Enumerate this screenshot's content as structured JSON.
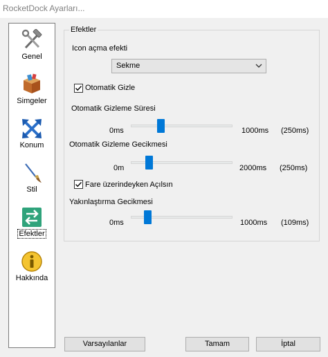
{
  "window": {
    "title": "RocketDock Ayarları..."
  },
  "sidebar": {
    "items": [
      {
        "label": "Genel",
        "icon": "tools-icon"
      },
      {
        "label": "Simgeler",
        "icon": "box-icon"
      },
      {
        "label": "Konum",
        "icon": "position-arrows-icon"
      },
      {
        "label": "Stil",
        "icon": "brush-icon"
      },
      {
        "label": "Efektler",
        "icon": "swap-arrows-icon"
      },
      {
        "label": "Hakkında",
        "icon": "info-icon"
      }
    ],
    "active": "Efektler"
  },
  "effects": {
    "group_title": "Efektler",
    "icon_open_effect": {
      "label": "Icon açma efekti",
      "selected": "Sekme"
    },
    "auto_hide": {
      "label": "Otomatik Gizle",
      "checked": true
    },
    "hide_duration": {
      "label": "Otomatik Gizleme Süresi",
      "min": "0ms",
      "max": "1000ms",
      "value_label": "(250ms)",
      "fraction": 0.25
    },
    "hide_delay": {
      "label": "Otomatik Gizleme Gecikmesi",
      "min": "0m",
      "max": "2000ms",
      "value_label": "(250ms)",
      "fraction": 0.125
    },
    "open_on_hover": {
      "label": "Fare üzerindeyken Açılsın",
      "checked": true
    },
    "zoom_delay": {
      "label": "Yakınlaştırma Gecikmesi",
      "min": "0ms",
      "max": "1000ms",
      "value_label": "(109ms)",
      "fraction": 0.109
    }
  },
  "buttons": {
    "defaults": "Varsayılanlar",
    "ok": "Tamam",
    "cancel": "İptal"
  },
  "colors": {
    "accent": "#0078d7"
  }
}
